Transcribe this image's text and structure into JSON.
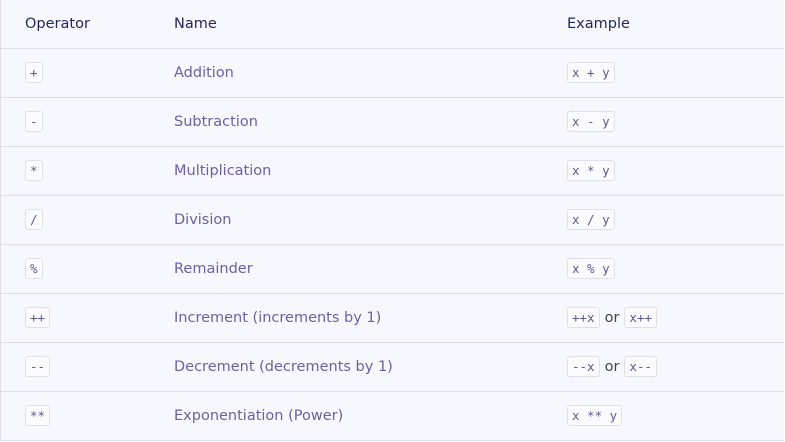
{
  "headers": {
    "operator": "Operator",
    "name": "Name",
    "example": "Example"
  },
  "rows": [
    {
      "op": "+",
      "name": "Addition",
      "ex1": "x + y",
      "or": "",
      "ex2": ""
    },
    {
      "op": "-",
      "name": "Subtraction",
      "ex1": "x - y",
      "or": "",
      "ex2": ""
    },
    {
      "op": "*",
      "name": "Multiplication",
      "ex1": "x * y",
      "or": "",
      "ex2": ""
    },
    {
      "op": "/",
      "name": "Division",
      "ex1": "x / y",
      "or": "",
      "ex2": ""
    },
    {
      "op": "%",
      "name": "Remainder",
      "ex1": "x % y",
      "or": "",
      "ex2": ""
    },
    {
      "op": "++",
      "name": "Increment (increments by 1)",
      "ex1": "++x",
      "or": "or",
      "ex2": "x++"
    },
    {
      "op": "--",
      "name": "Decrement (decrements by 1)",
      "ex1": "--x",
      "or": "or",
      "ex2": "x--"
    },
    {
      "op": "**",
      "name": "Exponentiation (Power)",
      "ex1": "x ** y",
      "or": "",
      "ex2": ""
    }
  ]
}
